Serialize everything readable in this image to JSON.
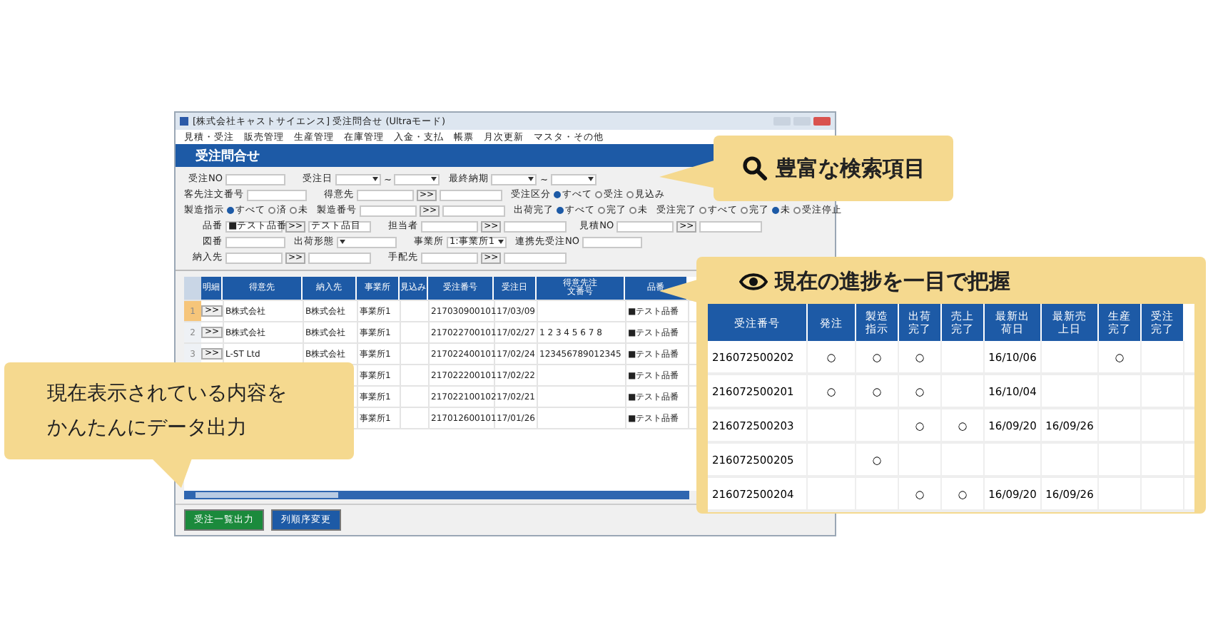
{
  "window": {
    "title": "[株式会社キャストサイエンス] 受注問合せ (Ultraモード)",
    "menus": [
      "見積・受注",
      "販売管理",
      "生産管理",
      "在庫管理",
      "入金・支払",
      "帳票",
      "月次更新",
      "マスタ・その他"
    ],
    "header": "受注問合せ",
    "form": [
      [
        {
          "kind": "text",
          "label": "受注NO"
        },
        {
          "kind": "range",
          "label": "受注日",
          "separator": "~"
        },
        {
          "kind": "range",
          "label": "最終納期",
          "separator": "~"
        }
      ],
      [
        {
          "kind": "text",
          "label": "客先注文番号"
        },
        {
          "kind": "lookup",
          "label": "得意先",
          "button": ">>"
        },
        {
          "kind": "radio",
          "label": "受注区分",
          "options": [
            {
              "label": "すべて",
              "selected": true
            },
            {
              "label": "受注",
              "selected": false
            },
            {
              "label": "見込み",
              "selected": false
            }
          ]
        }
      ],
      [
        {
          "kind": "radio",
          "label": "製造指示",
          "options": [
            {
              "label": "すべて",
              "selected": true
            },
            {
              "label": "済",
              "selected": false
            },
            {
              "label": "未",
              "selected": false
            }
          ]
        },
        {
          "kind": "lookup",
          "label": "製造番号",
          "button": ">>"
        },
        {
          "kind": "radio",
          "label": "出荷完了",
          "options": [
            {
              "label": "すべて",
              "selected": true
            },
            {
              "label": "完了",
              "selected": false
            },
            {
              "label": "未",
              "selected": false
            }
          ]
        },
        {
          "kind": "radio",
          "label": "受注完了",
          "options": [
            {
              "label": "すべて",
              "selected": false
            },
            {
              "label": "完了",
              "selected": false
            },
            {
              "label": "未",
              "selected": true
            },
            {
              "label": "受注停止",
              "selected": false
            }
          ]
        }
      ],
      [
        {
          "kind": "lookup",
          "label": "品番",
          "value": "■テスト品番",
          "button": ">>",
          "name": "テスト品目"
        },
        {
          "kind": "lookup",
          "label": "担当者",
          "button": ">>"
        },
        {
          "kind": "lookup",
          "label": "見積NO",
          "button": ">>"
        }
      ],
      [
        {
          "kind": "text",
          "label": "図番"
        },
        {
          "kind": "select",
          "label": "出荷形態"
        },
        {
          "kind": "select",
          "label": "事業所",
          "value": "1:事業所1"
        },
        {
          "kind": "text",
          "label": "連携先受注NO"
        }
      ],
      [
        {
          "kind": "lookup",
          "label": "納入先",
          "button": ">>"
        },
        {
          "kind": "lookup",
          "label": "手配先",
          "button": ">>"
        }
      ]
    ],
    "grid": {
      "columns": [
        "明細",
        "得意先",
        "納入先",
        "事業所",
        "見込み",
        "受注番号",
        "受注日",
        "得意先注文番号",
        "品番"
      ],
      "rows": [
        {
          "no": "1",
          "selected": true,
          "cells": [
            ">>",
            "B株式会社",
            "B株式会社",
            "事業所1",
            "",
            "217030900101",
            "17/03/09",
            "",
            "■テスト品番"
          ]
        },
        {
          "no": "2",
          "selected": false,
          "cells": [
            ">>",
            "B株式会社",
            "B株式会社",
            "事業所1",
            "",
            "217022700101",
            "17/02/27",
            "1 2 3 4 5 6 7 8",
            "■テスト品番"
          ]
        },
        {
          "no": "3",
          "selected": false,
          "cells": [
            ">>",
            "L-ST Ltd",
            "B株式会社",
            "事業所1",
            "",
            "217022400101",
            "17/02/24",
            "123456789012345",
            "■テスト品番"
          ]
        },
        {
          "cells": [
            "",
            "",
            "",
            "事業所1",
            "",
            "217022200101",
            "17/02/22",
            "",
            "■テスト品番"
          ]
        },
        {
          "cells": [
            "",
            "",
            "",
            "事業所1",
            "",
            "217022100102",
            "17/02/21",
            "",
            "■テスト品番"
          ]
        },
        {
          "cells": [
            "",
            "",
            "",
            "事業所1",
            "",
            "217012600101",
            "17/01/26",
            "",
            "■テスト品番"
          ]
        }
      ]
    },
    "buttons": [
      {
        "label": "受注一覧出力",
        "kind": "primary"
      },
      {
        "label": "列順序変更",
        "kind": "secondary"
      }
    ]
  },
  "callouts": [
    {
      "kind": "search",
      "text": "豊富な検索項目"
    },
    {
      "kind": "progress",
      "title": "現在の進捗を一目で把握",
      "columns": [
        "受注番号",
        "発注",
        "製造指示",
        "出荷完了",
        "売上完了",
        "最新出荷日",
        "最新売上日",
        "生産完了",
        "受注完了"
      ],
      "rows": [
        [
          "216072500202",
          "○",
          "○",
          "○",
          "",
          "16/10/06",
          "",
          "○",
          ""
        ],
        [
          "216072500201",
          "○",
          "○",
          "○",
          "",
          "16/10/04",
          "",
          "",
          ""
        ],
        [
          "216072500203",
          "",
          "",
          "○",
          "○",
          "16/09/20",
          "16/09/26",
          "",
          ""
        ],
        [
          "216072500205",
          "",
          "○",
          "",
          "",
          "",
          "",
          "",
          ""
        ],
        [
          "216072500204",
          "",
          "",
          "○",
          "○",
          "16/09/20",
          "16/09/26",
          "",
          ""
        ]
      ]
    },
    {
      "kind": "note",
      "lines": [
        "現在表示されている内容を",
        "かんたんにデータ出力"
      ]
    }
  ]
}
